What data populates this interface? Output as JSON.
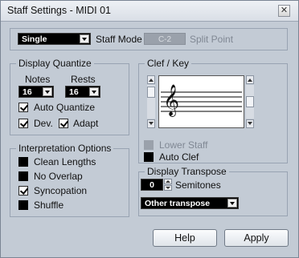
{
  "window": {
    "title": "Staff Settings - MIDI 01",
    "close_glyph": "✕"
  },
  "staff_mode": {
    "selected": "Single",
    "label": "Staff Mode",
    "split_point_value": "C-2",
    "split_point_label": "Split Point"
  },
  "display_quantize": {
    "title": "Display Quantize",
    "notes_label": "Notes",
    "rests_label": "Rests",
    "notes_value": "16",
    "rests_value": "16",
    "auto_quantize_label": "Auto Quantize",
    "auto_quantize_checked": true,
    "dev_label": "Dev.",
    "dev_checked": true,
    "adapt_label": "Adapt",
    "adapt_checked": true
  },
  "interpretation": {
    "title": "Interpretation Options",
    "options": [
      {
        "label": "Clean Lengths",
        "checked": false
      },
      {
        "label": "No Overlap",
        "checked": false
      },
      {
        "label": "Syncopation",
        "checked": true
      },
      {
        "label": "Shuffle",
        "checked": false
      }
    ]
  },
  "clef_key": {
    "title": "Clef / Key",
    "clef_glyph": "𝄞",
    "lower_staff_label": "Lower Staff",
    "lower_staff_enabled": false,
    "auto_clef_label": "Auto Clef",
    "auto_clef_checked": false
  },
  "display_transpose": {
    "title": "Display Transpose",
    "semitones_value": "0",
    "semitones_label": "Semitones",
    "transpose_selected": "Other transpose"
  },
  "buttons": {
    "help": "Help",
    "apply": "Apply"
  },
  "colors": {
    "background": "#c3cbd5",
    "field": "#000000",
    "field_text": "#ffffff"
  }
}
